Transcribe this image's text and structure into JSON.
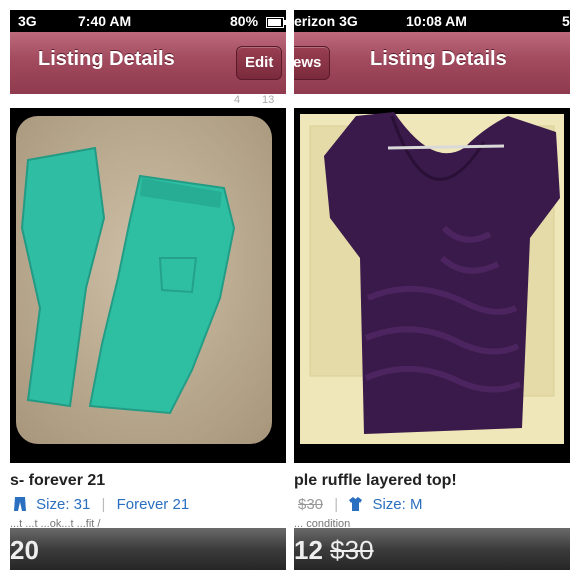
{
  "left": {
    "status": {
      "carrier": "3G",
      "time": "7:40 AM",
      "battery": "80%",
      "battery_level": 0.8
    },
    "nav": {
      "title": "Listing Details",
      "right_button": "Edit"
    },
    "counts": [
      "4",
      "13"
    ],
    "item": {
      "title": "s- forever 21",
      "size": "Size: 31",
      "brand": "Forever 21",
      "desc_peek": "...t              ...t   ...ok...t   ...fit /",
      "price": "20"
    }
  },
  "right": {
    "status": {
      "carrier": "erizon  3G",
      "time": "10:08 AM",
      "battery": "5"
    },
    "nav": {
      "title": "Listing Details",
      "left_button": "ews"
    },
    "item": {
      "title": "ple ruffle layered top!",
      "original_price": "$30",
      "size": "Size: M",
      "desc_peek": "... condition",
      "price": "12",
      "price_original": "$30"
    }
  },
  "colors": {
    "nav": "#a24a5e",
    "link": "#2a6fc0",
    "pants": "#2ebfa3",
    "top": "#3a1a4a"
  },
  "icons": {
    "pants": "pants-icon",
    "shirt": "shirt-icon"
  }
}
